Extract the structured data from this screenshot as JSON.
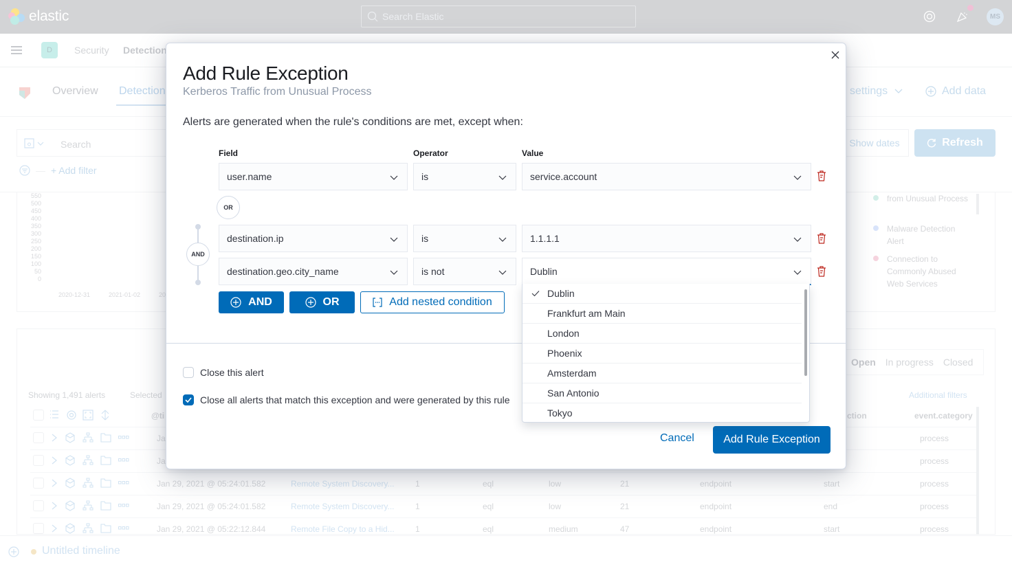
{
  "topbar": {
    "brand": "elastic",
    "search_placeholder": "Search Elastic",
    "avatar_initials": "MS"
  },
  "breadcrumbs": {
    "space_initial": "D",
    "items": [
      "Security",
      "Detection"
    ]
  },
  "nav": {
    "tabs": [
      "Overview",
      "Detection"
    ],
    "active_tab": "Detection",
    "settings_label": "settings",
    "add_data_label": "Add data"
  },
  "querybar": {
    "search_placeholder": "Search",
    "show_dates_label": "Show dates",
    "refresh_label": "Refresh",
    "add_filter_label": "+ Add filter"
  },
  "chart_bg": {
    "y_ticks": [
      "550",
      "500",
      "450",
      "400",
      "350",
      "300",
      "250",
      "200",
      "150",
      "100",
      "50",
      "0"
    ],
    "x_ticks": [
      "2020-12-31",
      "2021-01-02",
      "20"
    ],
    "legend": [
      {
        "label": "from Unusual Process",
        "color": "#d3efe9"
      },
      {
        "label": "Malware Detection Alert",
        "color": "#d9e4fb"
      },
      {
        "label": "Connection to Commonly Abused Web Services",
        "color": "#f6d4df"
      }
    ]
  },
  "alerts_table": {
    "showing_label": "Showing 1,491 alerts",
    "selected_label": "Selected",
    "status_tabs": [
      "Open",
      "In progress",
      "Closed"
    ],
    "additional_filters_label": "Additional filters",
    "columns": [
      "@ti",
      "ction",
      "event.category"
    ],
    "rows": [
      {
        "time": "Ja",
        "rule": "",
        "version": "",
        "type": "",
        "severity": "",
        "score": "",
        "module": "",
        "action": "",
        "category": "process"
      },
      {
        "time": "Ja",
        "rule": "",
        "version": "",
        "type": "",
        "severity": "",
        "score": "",
        "module": "",
        "action": "",
        "category": "process"
      },
      {
        "time": "Jan 29, 2021 @ 05:24:01.582",
        "rule": "Remote System Discovery...",
        "version": "1",
        "type": "eql",
        "severity": "low",
        "score": "21",
        "module": "endpoint",
        "action": "start",
        "category": "process"
      },
      {
        "time": "Jan 29, 2021 @ 05:24:01.582",
        "rule": "Remote System Discovery...",
        "version": "1",
        "type": "eql",
        "severity": "low",
        "score": "21",
        "module": "endpoint",
        "action": "end",
        "category": "process"
      },
      {
        "time": "Jan 29, 2021 @ 05:22:12.844",
        "rule": "Remote File Copy to a Hid...",
        "version": "1",
        "type": "eql",
        "severity": "medium",
        "score": "47",
        "module": "endpoint",
        "action": "start",
        "category": "process"
      }
    ]
  },
  "timeline": {
    "label": "Untitled timeline"
  },
  "modal": {
    "title": "Add Rule Exception",
    "subtitle": "Kerberos Traffic from Unusual Process",
    "description": "Alerts are generated when the rule's conditions are met, except when:",
    "column_labels": {
      "field": "Field",
      "operator": "Operator",
      "value": "Value"
    },
    "or_badge": "OR",
    "and_badge": "AND",
    "entries": [
      {
        "field": "user.name",
        "operator": "is",
        "value": "service.account"
      },
      {
        "field": "destination.ip",
        "operator": "is",
        "value": "1.1.1.1"
      },
      {
        "field": "destination.geo.city_name",
        "operator": "is not",
        "value": "Dublin"
      }
    ],
    "and_button": "AND",
    "or_button": "OR",
    "nested_button": "Add nested condition",
    "close_alert_label": "Close this alert",
    "close_alert_checked": false,
    "close_all_label": "Close all alerts that match this exception and were generated by this rule",
    "close_all_checked": true,
    "cancel_label": "Cancel",
    "submit_label": "Add Rule Exception"
  },
  "value_dropdown": {
    "selected": "Dublin",
    "options": [
      "Dublin",
      "Frankfurt am Main",
      "London",
      "Phoenix",
      "Amsterdam",
      "San Antonio",
      "Tokyo"
    ]
  },
  "colors": {
    "primary": "#006bb8",
    "danger": "#bd271e",
    "title": "#1a1c21",
    "subtitle": "#8d98a8"
  }
}
